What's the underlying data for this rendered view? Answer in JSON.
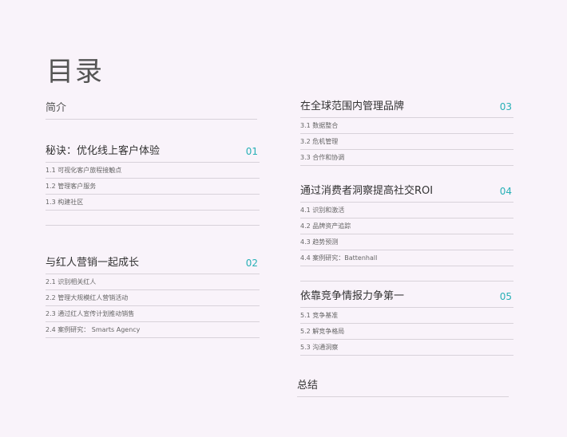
{
  "page_title": "目录",
  "left": {
    "intro": {
      "title": "简介"
    },
    "sections": [
      {
        "title": "秘诀：优化线上客户体验",
        "number": "01",
        "items": [
          "1.1 可视化客户旅程接触点",
          "1.2 管理客户服务",
          "1.3 构建社区"
        ]
      },
      {
        "title": "与红人营销一起成长",
        "number": "02",
        "items": [
          "2.1 识别相关红人",
          "2.2 管理大规模红人营销活动",
          "2.3 通过红人宣传计划推动销售",
          "2.4 案例研究： Smarts Agency"
        ]
      }
    ]
  },
  "right": {
    "sections": [
      {
        "title": "在全球范围内管理品牌",
        "number": "03",
        "items": [
          "3.1 数据整合",
          "3.2 危机管理",
          "3.3 合作和协调"
        ]
      },
      {
        "title": "通过消费者洞察提高社交ROI",
        "number": "04",
        "items": [
          "4.1 识别和激活",
          "4.2 品牌资产追踪",
          "4.3 趋势预测",
          "4.4 案例研究：Battenhall"
        ]
      },
      {
        "title": "依靠竞争情报力争第一",
        "number": "05",
        "items": [
          "5.1 竞争基准",
          "5.2 解竞争格局",
          "5.3 沟通洞察"
        ]
      }
    ],
    "summary": {
      "title": "总结"
    }
  }
}
